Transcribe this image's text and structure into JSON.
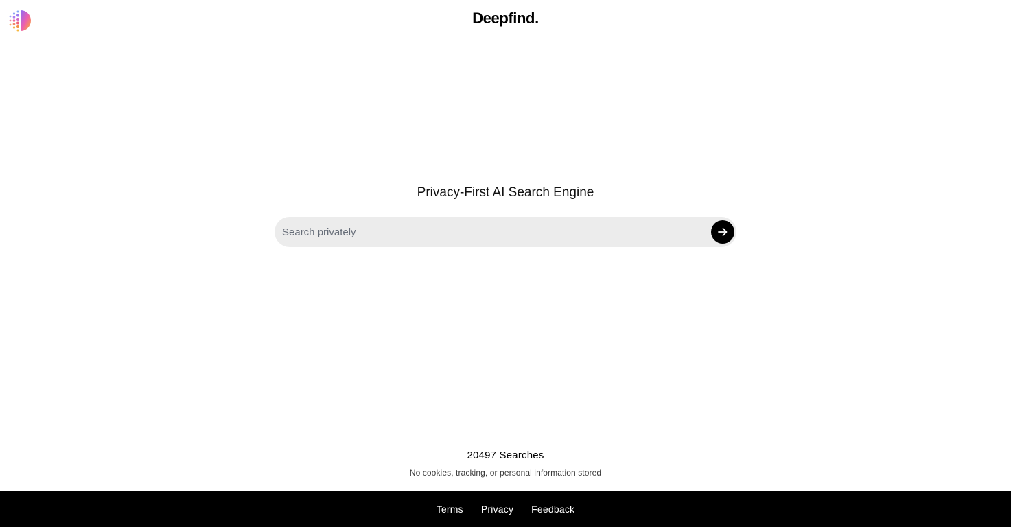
{
  "header": {
    "brand": "Deepfind."
  },
  "main": {
    "tagline": "Privacy-First AI Search Engine",
    "search": {
      "placeholder": "Search privately",
      "value": ""
    }
  },
  "stats": {
    "count": "20497 Searches",
    "note": "No cookies, tracking, or personal information stored"
  },
  "footer": {
    "links": [
      {
        "label": "Terms"
      },
      {
        "label": "Privacy"
      },
      {
        "label": "Feedback"
      }
    ]
  },
  "icons": {
    "logo": "dot-grid-logo-icon",
    "submit": "arrow-right-icon"
  },
  "colors": {
    "search_bg": "#ececec",
    "button_bg": "#000000",
    "footer_bg": "#000000"
  }
}
